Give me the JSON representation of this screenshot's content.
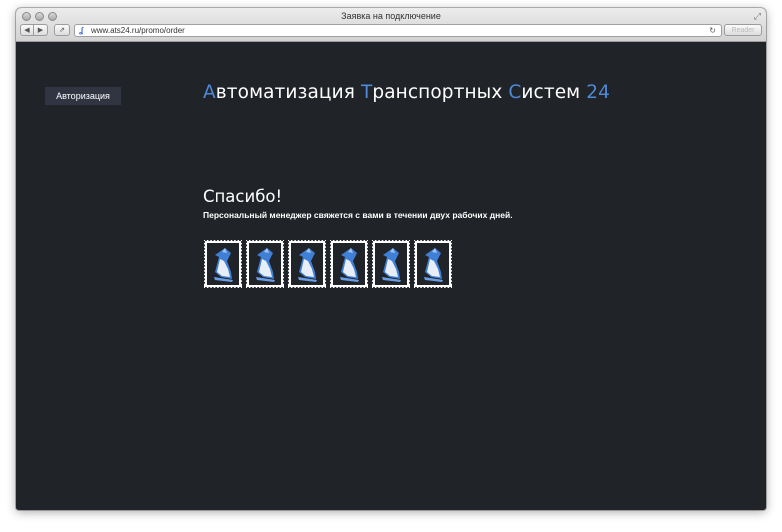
{
  "browser": {
    "title": "Заявка на подключение",
    "url": "www.ats24.ru/promo/order",
    "reader_label": "Reader",
    "back_glyph": "◀",
    "forward_glyph": "▶",
    "share_glyph": "⇗",
    "reload_glyph": "↻",
    "fullscreen_glyph": "⤢",
    "favicon_glyph": "ʆ"
  },
  "header": {
    "auth_button": "Авторизация",
    "brand": [
      {
        "initial": "А",
        "rest": "втоматизация "
      },
      {
        "initial": "Т",
        "rest": "ранспортных "
      },
      {
        "initial": "С",
        "rest": "истем "
      },
      {
        "initial": "",
        "rest": "",
        "number": "24"
      }
    ]
  },
  "main": {
    "heading": "Спасибо!",
    "message": "Персональный менеджер свяжется с вами в течении двух рабочих дней."
  },
  "stamps": {
    "count": 6,
    "icon": "penguin-stamp-icon"
  },
  "colors": {
    "background": "#202328",
    "accent": "#4d8ad9",
    "button_bg": "#303541"
  }
}
